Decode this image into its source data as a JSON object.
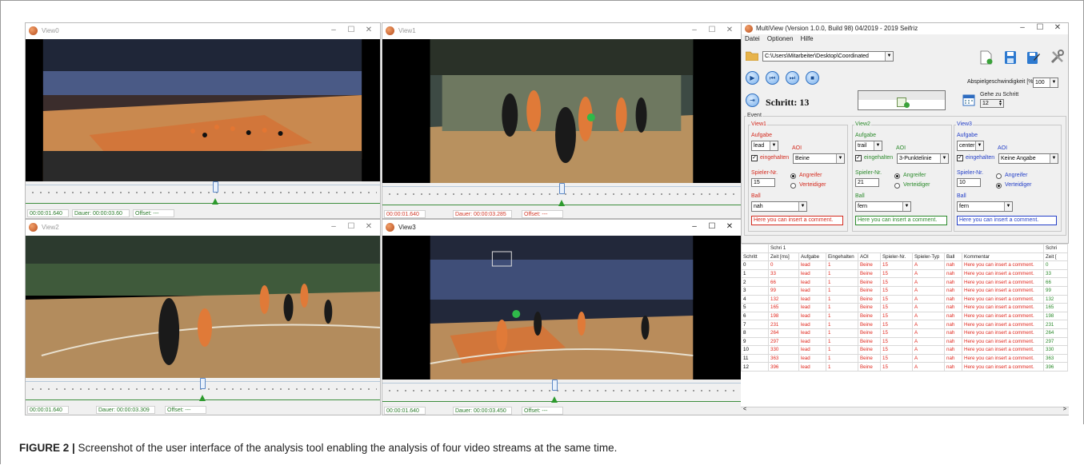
{
  "views": [
    {
      "title": "View0",
      "time": "00:00:01.640",
      "dauer": "Dauer: 00:00:03.60",
      "offset": "Offset: ---"
    },
    {
      "title": "View1",
      "time": "00:00:01.640",
      "dauer": "Dauer: 00:00:03.285",
      "offset": "Offset: ---"
    },
    {
      "title": "View2",
      "time": "00:00:01.640",
      "dauer": "Dauer: 00:00:03.309",
      "offset": "Offset: ---"
    },
    {
      "title": "View3",
      "time": "00:00:01.640",
      "dauer": "Dauer: 00:00:03.450",
      "offset": "Offset: ---"
    }
  ],
  "window_controls": {
    "minimize": "–",
    "maximize": "☐",
    "close": "✕"
  },
  "multiview": {
    "title": "MultiView  (Version 1.0.0, Build 98) 04/2019 - 2019 Seifriz",
    "menu": [
      "Datei",
      "Optionen",
      "Hilfe"
    ],
    "path": "C:\\Users\\Mitarbeiter\\Desktop\\Coordinated",
    "speed_label": "Abspielgeschwindigkeit [%]",
    "speed_value": "100",
    "step_label": "Schritt: 13",
    "goto_label": "Gehe zu Schritt",
    "goto_value": "12",
    "event_label": "Event",
    "labels": {
      "aufgabe": "Aufgabe",
      "aoi": "AOI",
      "eingehalten": "eingehalten",
      "spieler_nr": "Spieler-Nr.",
      "angreifer": "Angreifer",
      "verteidiger": "Verteidiger",
      "ball": "Ball"
    },
    "groups": [
      {
        "name": "View1",
        "aufgabe": "lead",
        "aoi": "Beine",
        "spieler": "15",
        "role": "Angreifer",
        "ball": "nah",
        "comment": "Here you can insert a comment.",
        "color": "#d42a1e"
      },
      {
        "name": "View2",
        "aufgabe": "trail",
        "aoi": "3-Punktelinie",
        "spieler": "21",
        "role": "Angreifer",
        "ball": "fern",
        "comment": "Here you can insert a comment.",
        "color": "#2b8a2b"
      },
      {
        "name": "View3",
        "aufgabe": "center",
        "aoi": "Keine Angabe",
        "spieler": "10",
        "role": "Verteidiger",
        "ball": "fern",
        "comment": "Here you can insert a comment.",
        "color": "#2540c8"
      }
    ]
  },
  "table": {
    "group_header": "Schri 1",
    "group_header2": "Schri",
    "columns": [
      "Schritt",
      "Zeit [ms]",
      "Aufgabe",
      "Eingehalten",
      "AOI",
      "Spieler-Nr.",
      "Spieler-Typ",
      "Ball",
      "Kommentar",
      "Zeit ["
    ],
    "rows": [
      [
        "0",
        "0",
        "lead",
        "1",
        "Beine",
        "15",
        "A",
        "nah",
        "Here you can insert a comment.",
        "0"
      ],
      [
        "1",
        "33",
        "lead",
        "1",
        "Beine",
        "15",
        "A",
        "nah",
        "Here you can insert a comment.",
        "33"
      ],
      [
        "2",
        "66",
        "lead",
        "1",
        "Beine",
        "15",
        "A",
        "nah",
        "Here you can insert a comment.",
        "66"
      ],
      [
        "3",
        "99",
        "lead",
        "1",
        "Beine",
        "15",
        "A",
        "nah",
        "Here you can insert a comment.",
        "99"
      ],
      [
        "4",
        "132",
        "lead",
        "1",
        "Beine",
        "15",
        "A",
        "nah",
        "Here you can insert a comment.",
        "132"
      ],
      [
        "5",
        "165",
        "lead",
        "1",
        "Beine",
        "15",
        "A",
        "nah",
        "Here you can insert a comment.",
        "165"
      ],
      [
        "6",
        "198",
        "lead",
        "1",
        "Beine",
        "15",
        "A",
        "nah",
        "Here you can insert a comment.",
        "198"
      ],
      [
        "7",
        "231",
        "lead",
        "1",
        "Beine",
        "15",
        "A",
        "nah",
        "Here you can insert a comment.",
        "231"
      ],
      [
        "8",
        "264",
        "lead",
        "1",
        "Beine",
        "15",
        "A",
        "nah",
        "Here you can insert a comment.",
        "264"
      ],
      [
        "9",
        "297",
        "lead",
        "1",
        "Beine",
        "15",
        "A",
        "nah",
        "Here you can insert a comment.",
        "297"
      ],
      [
        "10",
        "330",
        "lead",
        "1",
        "Beine",
        "15",
        "A",
        "nah",
        "Here you can insert a comment.",
        "330"
      ],
      [
        "11",
        "363",
        "lead",
        "1",
        "Beine",
        "15",
        "A",
        "nah",
        "Here you can insert a comment.",
        "363"
      ],
      [
        "12",
        "396",
        "lead",
        "1",
        "Beine",
        "15",
        "A",
        "nah",
        "Here you can insert a comment.",
        "396"
      ]
    ]
  },
  "caption": {
    "label": "FIGURE 2 |",
    "text": " Screenshot of the user interface of the analysis tool enabling the analysis of four video streams at the same time."
  },
  "icons": {
    "folder": "folder-icon",
    "new": "new-file-icon",
    "save": "save-icon",
    "save_as": "save-as-icon",
    "tools": "tools-icon",
    "play": "play-icon",
    "prev": "previous-icon",
    "next": "next-icon",
    "stop": "stop-icon",
    "step": "step-icon",
    "calendar": "calendar-icon"
  },
  "colors": {
    "accent_blue": "#2f6fc0",
    "table_red": "#e0281e",
    "table_green": "#2c8a2c",
    "court_orange": "#d2763a"
  }
}
